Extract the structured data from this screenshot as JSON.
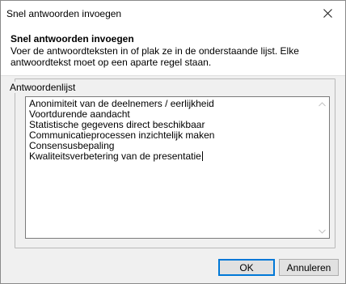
{
  "window": {
    "title": "Snel antwoorden invoegen",
    "close_glyph": "close-icon"
  },
  "header": {
    "title": "Snel antwoorden invoegen",
    "description": "Voer de antwoordteksten in of plak ze in de onderstaande lijst. Elke antwoordtekst moet op een aparte regel staan."
  },
  "answer_list": {
    "label": "Antwoordenlijst",
    "lines": [
      "Anonimiteit van de deelnemers / eerlijkheid",
      "Voortdurende aandacht",
      "Statistische gegevens direct beschikbaar",
      "Communicatieprocessen inzichtelijk maken",
      "Consensusbepaling",
      "Kwaliteitsverbetering van de presentatie"
    ]
  },
  "buttons": {
    "ok": "OK",
    "cancel": "Annuleren"
  },
  "colors": {
    "accent": "#0078d7",
    "dialog_bg": "#f0f0f0",
    "panel_bg": "#ffffff"
  }
}
